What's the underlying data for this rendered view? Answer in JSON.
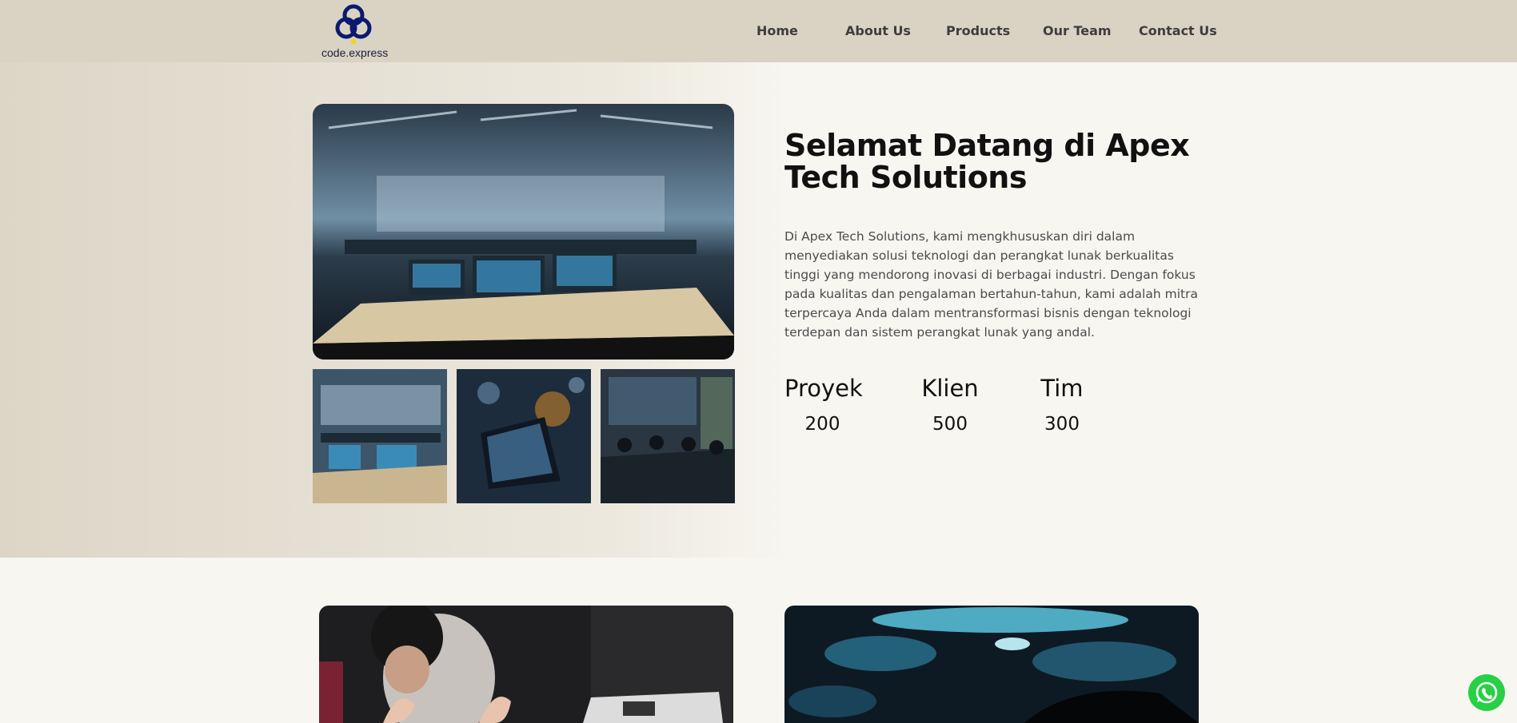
{
  "brand": {
    "name": "code.express"
  },
  "nav": {
    "items": [
      "Home",
      "About Us",
      "Products",
      "Our Team",
      "Contact Us"
    ]
  },
  "hero": {
    "title": "Selamat Datang di Apex Tech Solutions",
    "description": "Di Apex Tech Solutions, kami mengkhususkan diri dalam menyediakan solusi teknologi dan perangkat lunak berkualitas tinggi yang mendorong inovasi di berbagai industri. Dengan fokus pada kualitas dan pengalaman bertahun-tahun, kami adalah mitra terpercaya Anda dalam mentransformasi bisnis dengan teknologi terdepan dan sistem perangkat lunak yang andal.",
    "stats": [
      {
        "label": "Proyek",
        "value": "200"
      },
      {
        "label": "Klien",
        "value": "500"
      },
      {
        "label": "Tim",
        "value": "300"
      }
    ]
  },
  "colors": {
    "navbar": "#d9d3c3",
    "page_bg": "#f8f6f1",
    "logo": "#0b1a6e",
    "whatsapp": "#27d045"
  },
  "icons": [
    "logo-icon",
    "whatsapp-icon"
  ]
}
